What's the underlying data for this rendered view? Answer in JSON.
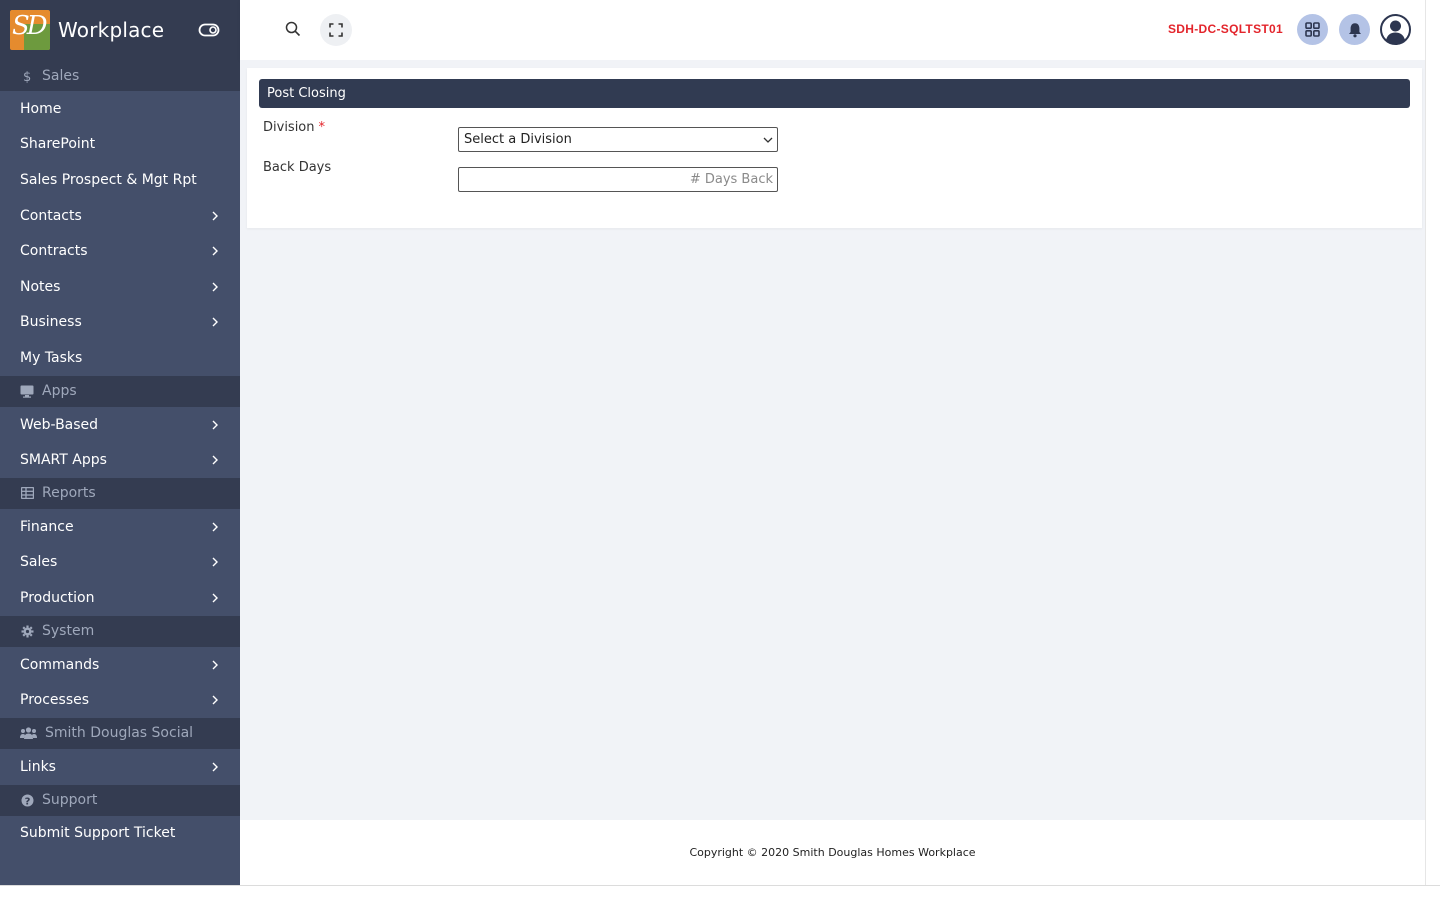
{
  "brand": {
    "title": "Workplace"
  },
  "sidebar": {
    "sections": [
      {
        "label": "Sales",
        "icon": "dollar-icon",
        "items": [
          {
            "label": "Home",
            "has_children": false
          },
          {
            "label": "SharePoint",
            "has_children": false
          },
          {
            "label": "Sales Prospect & Mgt Rpt",
            "has_children": false
          },
          {
            "label": "Contacts",
            "has_children": true
          },
          {
            "label": "Contracts",
            "has_children": true
          },
          {
            "label": "Notes",
            "has_children": true
          },
          {
            "label": "Business",
            "has_children": true
          },
          {
            "label": "My Tasks",
            "has_children": false
          }
        ]
      },
      {
        "label": "Apps",
        "icon": "monitor-icon",
        "items": [
          {
            "label": "Web-Based",
            "has_children": true
          },
          {
            "label": "SMART Apps",
            "has_children": true
          }
        ]
      },
      {
        "label": "Reports",
        "icon": "table-icon",
        "items": [
          {
            "label": "Finance",
            "has_children": true
          },
          {
            "label": "Sales",
            "has_children": true
          },
          {
            "label": "Production",
            "has_children": true
          }
        ]
      },
      {
        "label": "System",
        "icon": "gear-icon",
        "items": [
          {
            "label": "Commands",
            "has_children": true
          },
          {
            "label": "Processes",
            "has_children": true
          }
        ]
      },
      {
        "label": "Smith Douglas Social",
        "icon": "users-icon",
        "items": [
          {
            "label": "Links",
            "has_children": true
          }
        ]
      },
      {
        "label": "Support",
        "icon": "question-icon",
        "items": [
          {
            "label": "Submit Support Ticket",
            "has_children": false
          }
        ]
      }
    ]
  },
  "header": {
    "server_name": "SDH-DC-SQLTST01"
  },
  "form": {
    "title": "Post Closing",
    "division_label": "Division",
    "required_mark": "*",
    "division_value": "Select a Division",
    "back_days_label": "Back Days",
    "back_days_placeholder": "# Days Back"
  },
  "footer": {
    "copyright": "Copyright © 2020 Smith Douglas Homes Workplace"
  },
  "colors": {
    "sidebar": "#444f6a",
    "section": "#343c51",
    "accent_red": "#e3242b",
    "header_bar": "#313b52"
  }
}
